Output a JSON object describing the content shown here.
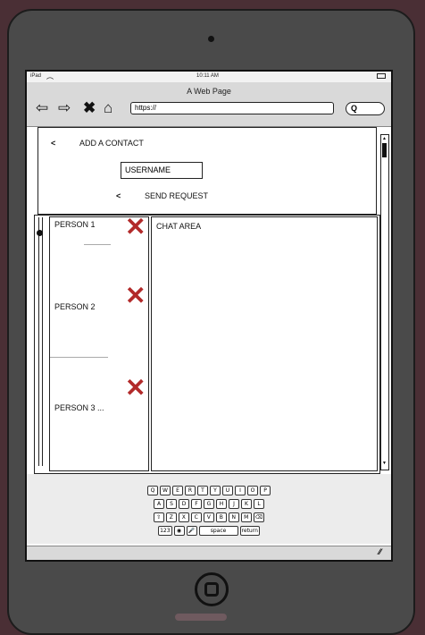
{
  "status_bar": {
    "device": "iPad",
    "time": "10:11 AM"
  },
  "browser": {
    "title": "A Web Page",
    "url": "https://",
    "search_glyph": "Q"
  },
  "add_contact": {
    "back_glyph": "<",
    "title": "ADD A CONTACT",
    "username_value": "USERNAME",
    "send_glyph": "<",
    "send_label": "SEND REQUEST"
  },
  "contacts": [
    {
      "name": "PERSON 1"
    },
    {
      "name": "PERSON 2"
    },
    {
      "name": "PERSON 3 ..."
    }
  ],
  "chat": {
    "label": "CHAT AREA"
  },
  "keyboard": {
    "row1": [
      "Q",
      "W",
      "E",
      "R",
      "T",
      "Y",
      "U",
      "I",
      "O",
      "P"
    ],
    "row2": [
      "A",
      "S",
      "D",
      "F",
      "G",
      "H",
      "J",
      "K",
      "L"
    ],
    "row3": [
      "⇧",
      "Z",
      "X",
      "C",
      "V",
      "B",
      "N",
      "M",
      "⌫"
    ],
    "row4": [
      "123",
      "◉",
      "🎤",
      "space",
      "return"
    ]
  },
  "icons": {
    "back": "arrow-left-icon",
    "forward": "arrow-right-icon",
    "stop": "close-icon",
    "home": "home-icon"
  },
  "colors": {
    "delete_x": "#b22a2a",
    "frame": "#4a4a4a"
  }
}
